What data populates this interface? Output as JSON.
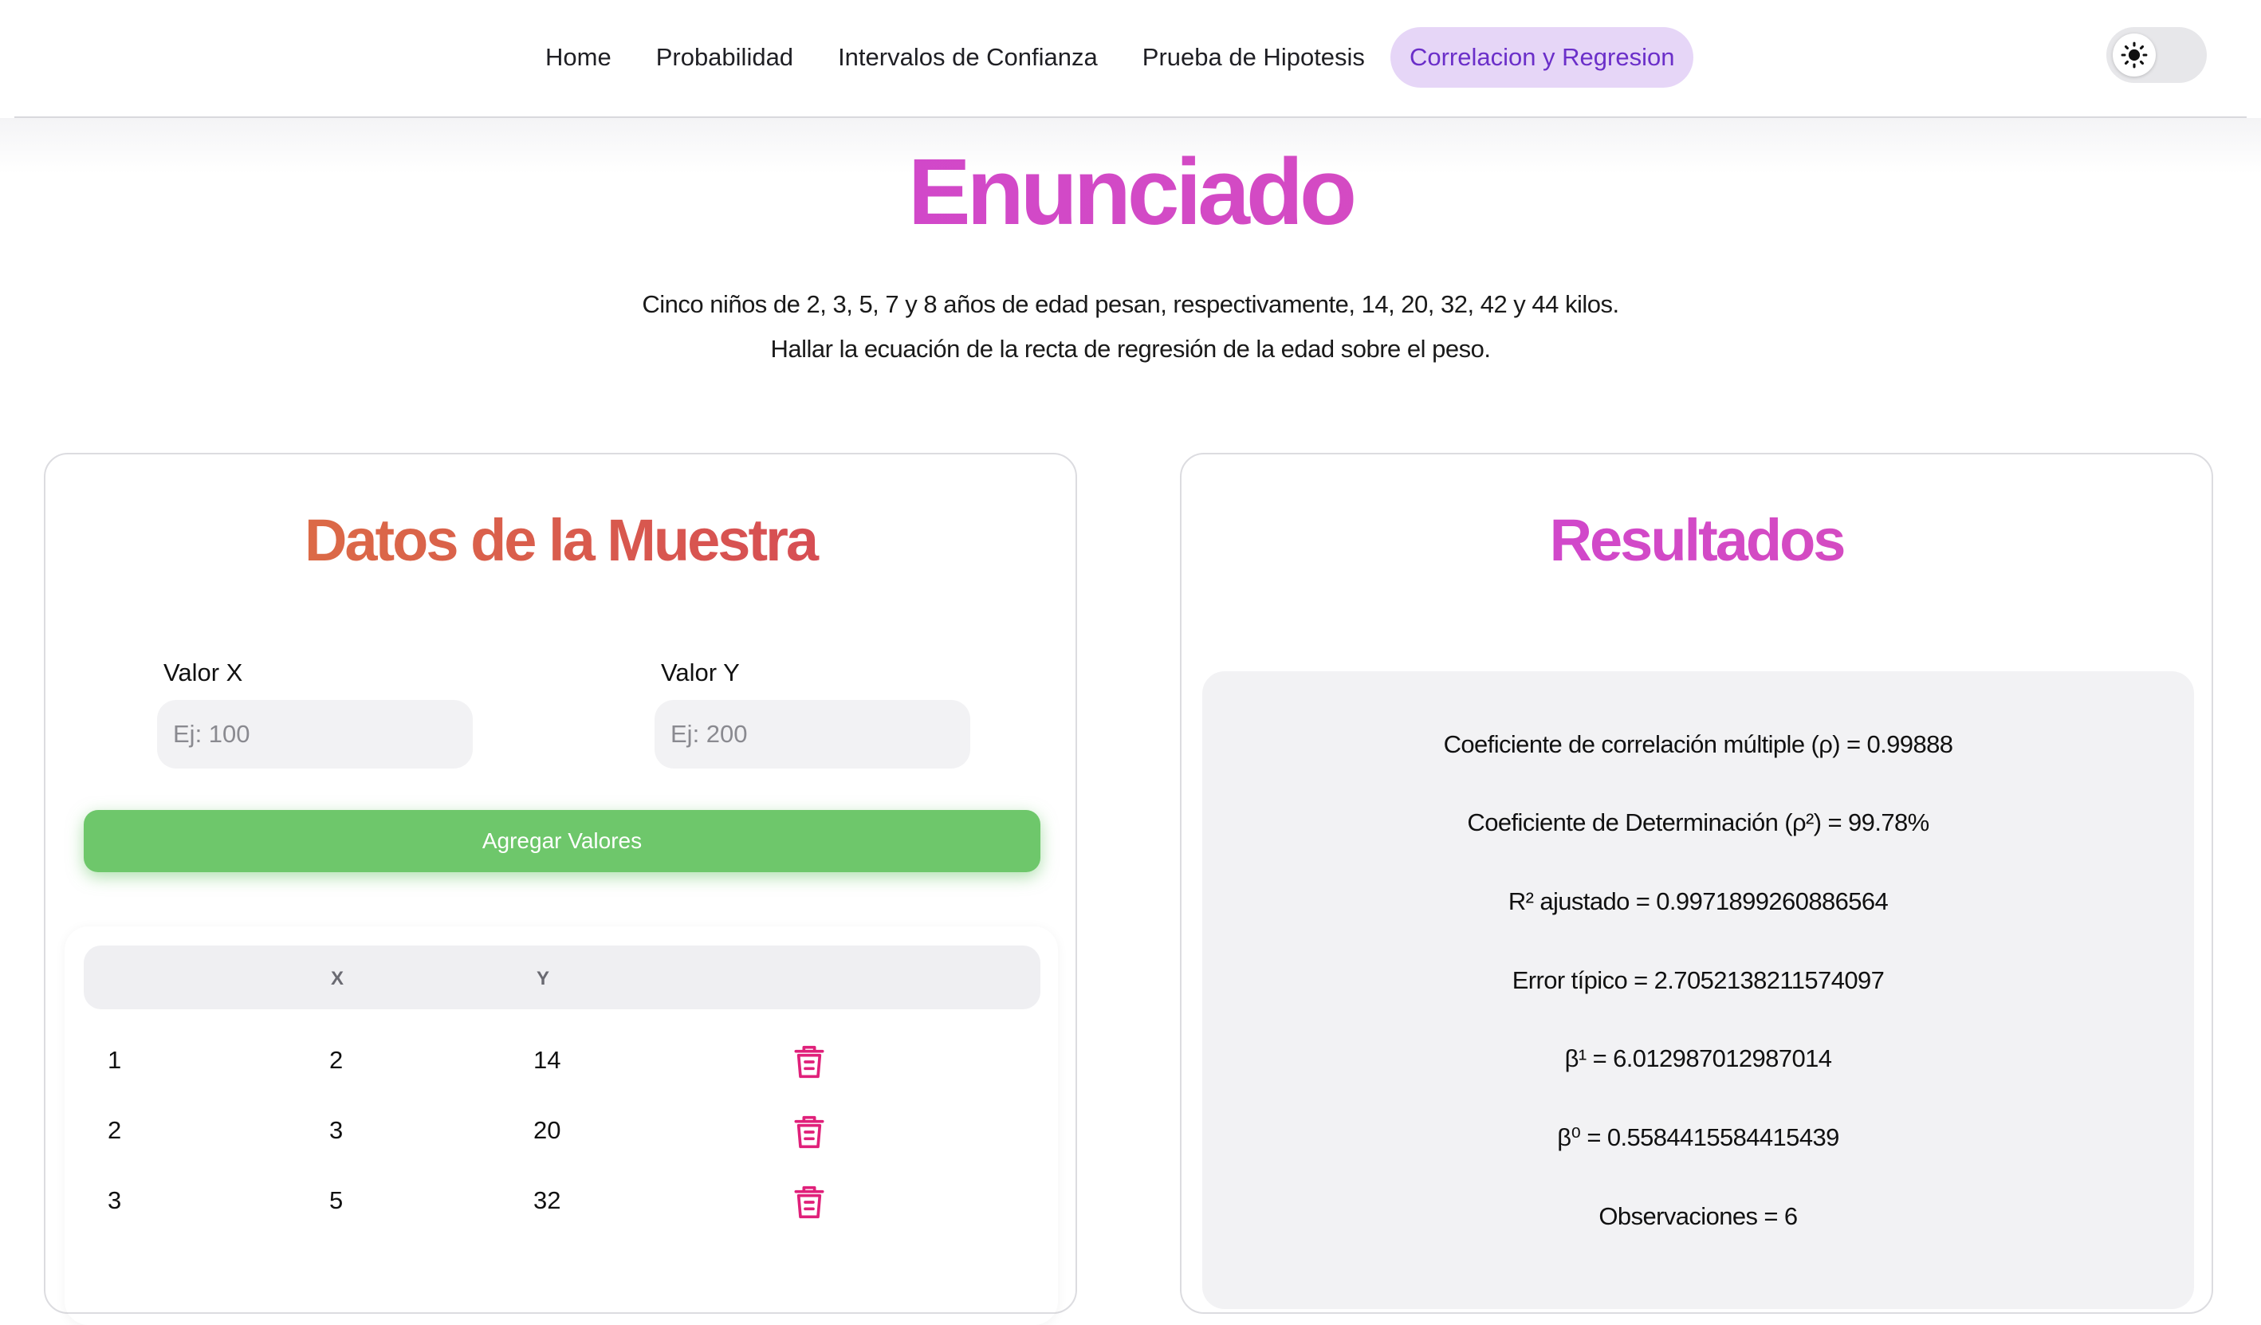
{
  "nav": {
    "items": [
      {
        "label": "Home"
      },
      {
        "label": "Probabilidad"
      },
      {
        "label": "Intervalos de Confianza"
      },
      {
        "label": "Prueba de Hipotesis"
      },
      {
        "label": "Correlacion y Regresion"
      }
    ],
    "active_index": 4,
    "theme_icon": "sun-icon"
  },
  "page": {
    "title": "Enunciado",
    "statement_line1": "Cinco niños de 2, 3, 5, 7 y 8 años de edad pesan, respectivamente, 14, 20, 32, 42 y 44 kilos.",
    "statement_line2": "Hallar la ecuación de la recta de regresión de la edad sobre el peso."
  },
  "sample": {
    "title": "Datos de la Muestra",
    "x_label": "Valor X",
    "x_placeholder": "Ej: 100",
    "y_label": "Valor Y",
    "y_placeholder": "Ej: 200",
    "add_button": "Agregar Valores",
    "columns": [
      "",
      "X",
      "Y",
      ""
    ],
    "rows": [
      {
        "index": "1",
        "x": "2",
        "y": "14"
      },
      {
        "index": "2",
        "x": "3",
        "y": "20"
      },
      {
        "index": "3",
        "x": "5",
        "y": "32"
      }
    ],
    "delete_icon": "trash-icon"
  },
  "results": {
    "title": "Resultados",
    "lines": [
      "Coeficiente de correlación múltiple (ρ) = 0.99888",
      "Coeficiente de Determinación (ρ²) = 99.78%",
      "R² ajustado = 0.9971899260886564",
      "Error típico = 2.7052138211574097",
      "β¹ = 6.012987012987014",
      "β⁰ = 0.5584415584415439",
      "Observaciones = 6"
    ]
  },
  "colors": {
    "active_nav_bg": "#e6d6f7",
    "active_nav_text": "#6b2fc9",
    "add_button": "#6ec76b",
    "trash": "#e0207a"
  }
}
